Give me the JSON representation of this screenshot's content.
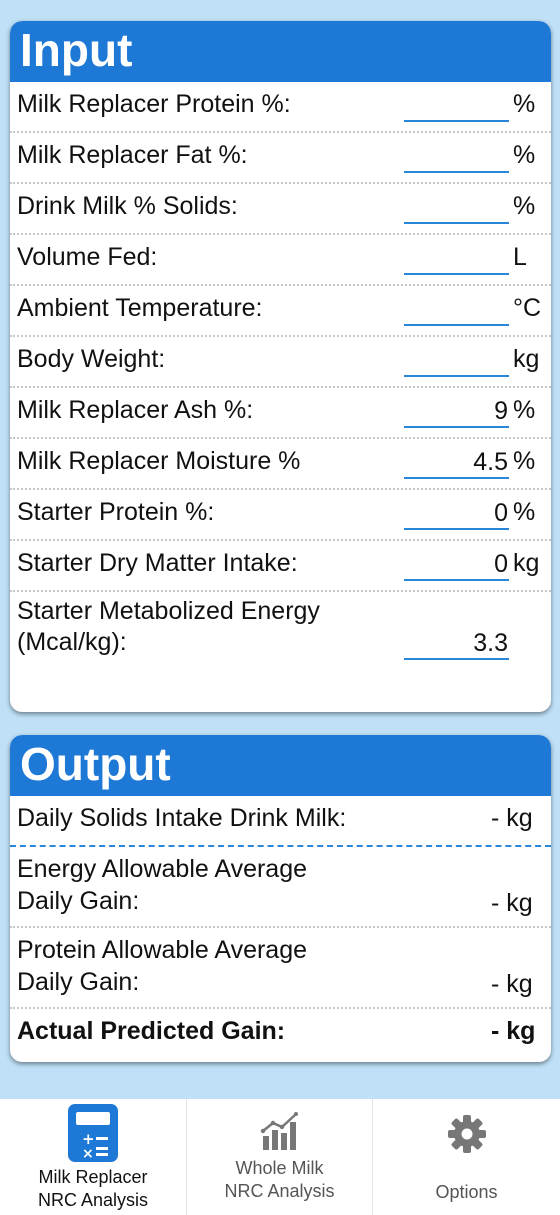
{
  "input": {
    "title": "Input",
    "rows": [
      {
        "label": "Milk Replacer Protein %:",
        "value": "",
        "unit": "%"
      },
      {
        "label": "Milk Replacer Fat %:",
        "value": "",
        "unit": "%"
      },
      {
        "label": "Drink Milk % Solids:",
        "value": "",
        "unit": "%"
      },
      {
        "label": "Volume Fed:",
        "value": "",
        "unit": "L"
      },
      {
        "label": "Ambient Temperature:",
        "value": "",
        "unit": "°C"
      },
      {
        "label": "Body Weight:",
        "value": "",
        "unit": "kg"
      },
      {
        "label": "Milk Replacer Ash %:",
        "value": "9",
        "unit": "%"
      },
      {
        "label": "Milk Replacer Moisture %",
        "value": "4.5",
        "unit": "%"
      },
      {
        "label": "Starter Protein %:",
        "value": "0",
        "unit": "%"
      },
      {
        "label": "Starter Dry Matter Intake:",
        "value": "0",
        "unit": "kg"
      },
      {
        "label_line1": "Starter Metabolized Energy",
        "label_line2": "(Mcal/kg):",
        "value": "3.3",
        "unit": ""
      }
    ]
  },
  "output": {
    "title": "Output",
    "rows": [
      {
        "label_line1": "Daily Solids Intake Drink Milk:",
        "value": "- kg"
      },
      {
        "label_line1": "Energy Allowable Average",
        "label_line2": "Daily Gain:",
        "value": "- kg"
      },
      {
        "label_line1": "Protein Allowable Average",
        "label_line2": "Daily Gain:",
        "value": "- kg"
      },
      {
        "label_line1": "Actual Predicted Gain:",
        "value": "- kg"
      }
    ]
  },
  "tabs": [
    {
      "line1": "Milk Replacer",
      "line2": "NRC Analysis",
      "icon": "calculator-icon",
      "active": true
    },
    {
      "line1": "Whole Milk",
      "line2": "NRC Analysis",
      "icon": "bar-chart-growth-icon",
      "active": false
    },
    {
      "line1": "Options",
      "line2": "",
      "icon": "gear-icon",
      "active": false
    }
  ],
  "colors": {
    "background": "#bfe0f7",
    "header": "#1e78d6",
    "field_underline": "#2a86d9",
    "active_icon": "#1e78d6",
    "inactive_icon": "#777777"
  }
}
